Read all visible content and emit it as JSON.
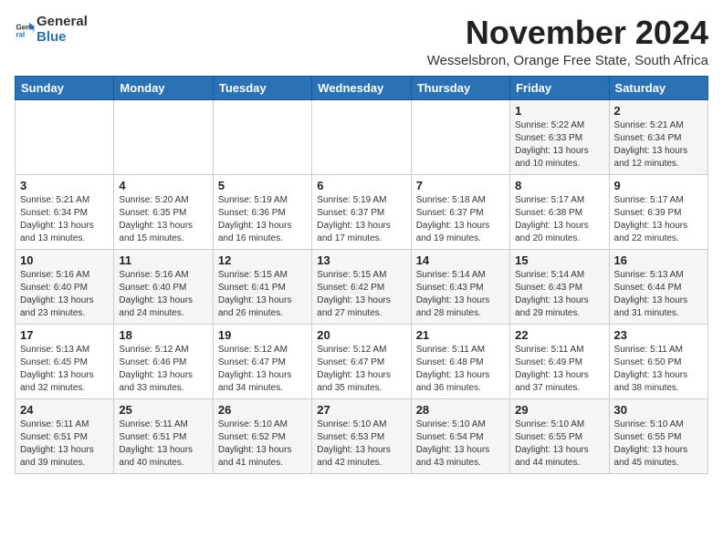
{
  "header": {
    "logo_general": "General",
    "logo_blue": "Blue",
    "title": "November 2024",
    "location": "Wesselsbron, Orange Free State, South Africa"
  },
  "weekdays": [
    "Sunday",
    "Monday",
    "Tuesday",
    "Wednesday",
    "Thursday",
    "Friday",
    "Saturday"
  ],
  "weeks": [
    [
      {
        "day": "",
        "info": ""
      },
      {
        "day": "",
        "info": ""
      },
      {
        "day": "",
        "info": ""
      },
      {
        "day": "",
        "info": ""
      },
      {
        "day": "",
        "info": ""
      },
      {
        "day": "1",
        "info": "Sunrise: 5:22 AM\nSunset: 6:33 PM\nDaylight: 13 hours\nand 10 minutes."
      },
      {
        "day": "2",
        "info": "Sunrise: 5:21 AM\nSunset: 6:34 PM\nDaylight: 13 hours\nand 12 minutes."
      }
    ],
    [
      {
        "day": "3",
        "info": "Sunrise: 5:21 AM\nSunset: 6:34 PM\nDaylight: 13 hours\nand 13 minutes."
      },
      {
        "day": "4",
        "info": "Sunrise: 5:20 AM\nSunset: 6:35 PM\nDaylight: 13 hours\nand 15 minutes."
      },
      {
        "day": "5",
        "info": "Sunrise: 5:19 AM\nSunset: 6:36 PM\nDaylight: 13 hours\nand 16 minutes."
      },
      {
        "day": "6",
        "info": "Sunrise: 5:19 AM\nSunset: 6:37 PM\nDaylight: 13 hours\nand 17 minutes."
      },
      {
        "day": "7",
        "info": "Sunrise: 5:18 AM\nSunset: 6:37 PM\nDaylight: 13 hours\nand 19 minutes."
      },
      {
        "day": "8",
        "info": "Sunrise: 5:17 AM\nSunset: 6:38 PM\nDaylight: 13 hours\nand 20 minutes."
      },
      {
        "day": "9",
        "info": "Sunrise: 5:17 AM\nSunset: 6:39 PM\nDaylight: 13 hours\nand 22 minutes."
      }
    ],
    [
      {
        "day": "10",
        "info": "Sunrise: 5:16 AM\nSunset: 6:40 PM\nDaylight: 13 hours\nand 23 minutes."
      },
      {
        "day": "11",
        "info": "Sunrise: 5:16 AM\nSunset: 6:40 PM\nDaylight: 13 hours\nand 24 minutes."
      },
      {
        "day": "12",
        "info": "Sunrise: 5:15 AM\nSunset: 6:41 PM\nDaylight: 13 hours\nand 26 minutes."
      },
      {
        "day": "13",
        "info": "Sunrise: 5:15 AM\nSunset: 6:42 PM\nDaylight: 13 hours\nand 27 minutes."
      },
      {
        "day": "14",
        "info": "Sunrise: 5:14 AM\nSunset: 6:43 PM\nDaylight: 13 hours\nand 28 minutes."
      },
      {
        "day": "15",
        "info": "Sunrise: 5:14 AM\nSunset: 6:43 PM\nDaylight: 13 hours\nand 29 minutes."
      },
      {
        "day": "16",
        "info": "Sunrise: 5:13 AM\nSunset: 6:44 PM\nDaylight: 13 hours\nand 31 minutes."
      }
    ],
    [
      {
        "day": "17",
        "info": "Sunrise: 5:13 AM\nSunset: 6:45 PM\nDaylight: 13 hours\nand 32 minutes."
      },
      {
        "day": "18",
        "info": "Sunrise: 5:12 AM\nSunset: 6:46 PM\nDaylight: 13 hours\nand 33 minutes."
      },
      {
        "day": "19",
        "info": "Sunrise: 5:12 AM\nSunset: 6:47 PM\nDaylight: 13 hours\nand 34 minutes."
      },
      {
        "day": "20",
        "info": "Sunrise: 5:12 AM\nSunset: 6:47 PM\nDaylight: 13 hours\nand 35 minutes."
      },
      {
        "day": "21",
        "info": "Sunrise: 5:11 AM\nSunset: 6:48 PM\nDaylight: 13 hours\nand 36 minutes."
      },
      {
        "day": "22",
        "info": "Sunrise: 5:11 AM\nSunset: 6:49 PM\nDaylight: 13 hours\nand 37 minutes."
      },
      {
        "day": "23",
        "info": "Sunrise: 5:11 AM\nSunset: 6:50 PM\nDaylight: 13 hours\nand 38 minutes."
      }
    ],
    [
      {
        "day": "24",
        "info": "Sunrise: 5:11 AM\nSunset: 6:51 PM\nDaylight: 13 hours\nand 39 minutes."
      },
      {
        "day": "25",
        "info": "Sunrise: 5:11 AM\nSunset: 6:51 PM\nDaylight: 13 hours\nand 40 minutes."
      },
      {
        "day": "26",
        "info": "Sunrise: 5:10 AM\nSunset: 6:52 PM\nDaylight: 13 hours\nand 41 minutes."
      },
      {
        "day": "27",
        "info": "Sunrise: 5:10 AM\nSunset: 6:53 PM\nDaylight: 13 hours\nand 42 minutes."
      },
      {
        "day": "28",
        "info": "Sunrise: 5:10 AM\nSunset: 6:54 PM\nDaylight: 13 hours\nand 43 minutes."
      },
      {
        "day": "29",
        "info": "Sunrise: 5:10 AM\nSunset: 6:55 PM\nDaylight: 13 hours\nand 44 minutes."
      },
      {
        "day": "30",
        "info": "Sunrise: 5:10 AM\nSunset: 6:55 PM\nDaylight: 13 hours\nand 45 minutes."
      }
    ]
  ]
}
